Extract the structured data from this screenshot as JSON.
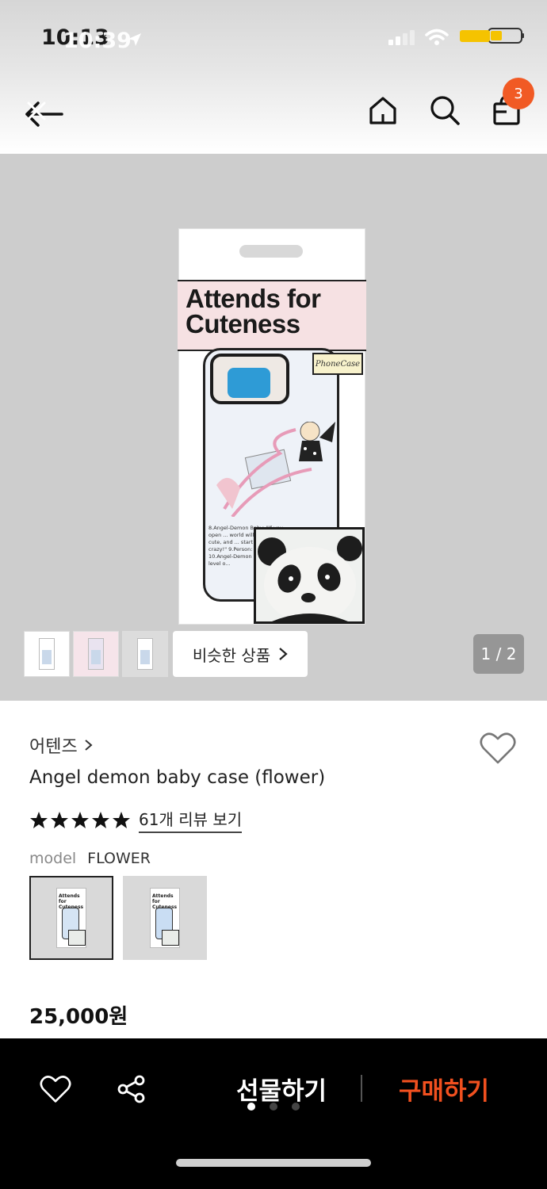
{
  "status_bar": {
    "time": "10:13",
    "time_overlay": "10:39",
    "network": "LTE"
  },
  "header": {
    "cart_count": "3"
  },
  "gallery": {
    "box_title": "Attends for Cuteness",
    "box_sticker": "PhoneCase",
    "case_text": "8.Angel-Demon Baby: \"If you open ... world will become too cute, and ... start pounding like crazy!\" 9.Person: \"Then... 10.Angel-Demon ... handle that level o...",
    "similar_label": "비슷한 상품",
    "page_indicator": "1 / 2"
  },
  "product": {
    "brand": "어텐즈",
    "name": "Angel demon baby case (flower)",
    "rating_stars": 5,
    "review_link": "61개 리뷰 보기",
    "option_key": "model",
    "option_value": "FLOWER",
    "price": "25,000원"
  },
  "bottom_bar": {
    "gift_label": "선물하기",
    "buy_label": "구매하기",
    "accent_color": "#f1501f"
  }
}
